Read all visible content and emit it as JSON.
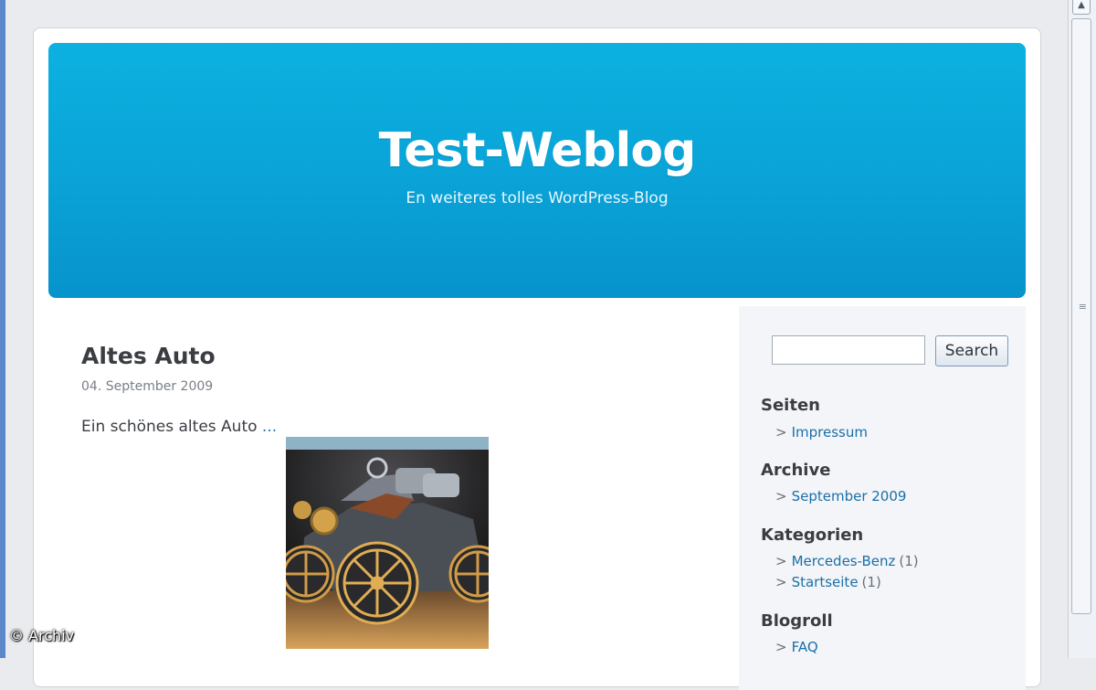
{
  "header": {
    "title": "Test-Weblog",
    "description": "En weiteres tolles WordPress-Blog"
  },
  "post": {
    "title": "Altes Auto",
    "date": "04. September 2009",
    "excerpt": "Ein schönes altes Auto",
    "more_link": " ...",
    "image_icon": "vintage-car-photo"
  },
  "sidebar": {
    "search": {
      "value": "",
      "button_label": "Search"
    },
    "widgets": [
      {
        "title": "Seiten",
        "items": [
          {
            "label": "Impressum"
          }
        ]
      },
      {
        "title": "Archive",
        "items": [
          {
            "label": "September 2009"
          }
        ]
      },
      {
        "title": "Kategorien",
        "items": [
          {
            "label": "Mercedes-Benz",
            "count": "(1)"
          },
          {
            "label": "Startseite",
            "count": "(1)"
          }
        ]
      },
      {
        "title": "Blogroll",
        "items": [
          {
            "label": "FAQ"
          }
        ]
      }
    ],
    "bullet": ">"
  },
  "watermark": "© Archiv",
  "colors": {
    "header_gradient_top": "#0cb1e0",
    "header_gradient_bottom": "#0793cc",
    "link": "#1c6fa8",
    "sidebar_bg": "#f3f5f8"
  }
}
